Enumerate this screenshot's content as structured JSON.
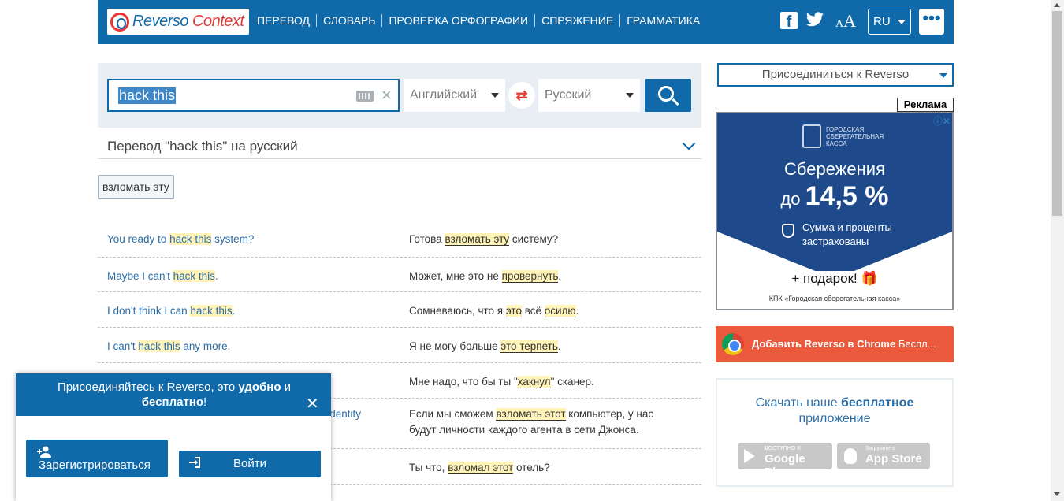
{
  "header": {
    "logo_reverso": "Reverso",
    "logo_context": "Context",
    "nav": [
      "ПЕРЕВОД",
      "СЛОВАРЬ",
      "ПРОВЕРКА ОРФОГРАФИИ",
      "СПРЯЖЕНИЕ",
      "ГРАММАТИКА"
    ],
    "language": "RU",
    "more": "•••"
  },
  "search": {
    "query": "hack this",
    "source_lang": "Английский",
    "target_lang": "Русский"
  },
  "translation": {
    "title": "Перевод \"hack this\" на русский",
    "chips": [
      "взломать эту"
    ]
  },
  "examples": [
    {
      "src": [
        "You ready to ",
        "hack this",
        " system?"
      ],
      "tgt": [
        "Готова ",
        "взломать эту",
        " систему?"
      ]
    },
    {
      "src": [
        "Maybe I can't ",
        "hack this",
        "."
      ],
      "tgt": [
        "Может, мне это не ",
        "провернуть",
        "."
      ]
    },
    {
      "src": [
        "I don't think I can ",
        "hack this",
        "."
      ],
      "tgt": [
        "Сомневаюсь, что я ",
        "это",
        " всё ",
        "осилю",
        "."
      ]
    },
    {
      "src": [
        "I can't ",
        "hack this",
        " any more."
      ],
      "tgt": [
        "Я не могу больше ",
        "это терпеть",
        "."
      ]
    },
    {
      "src": [
        "",
        "",
        ""
      ],
      "tgt": [
        "Мне надо, что бы ты \"",
        "хакнул",
        "\" сканер."
      ]
    },
    {
      "src": [
        "",
        "",
        "e identity"
      ],
      "tgt": [
        "Если мы сможем ",
        "взломать этот",
        " компьютер, у нас будут личности каждого агента в сети Джонса."
      ]
    },
    {
      "src": [
        "",
        "",
        ""
      ],
      "tgt": [
        "Ты что, ",
        "взломал этот",
        " отель?"
      ]
    }
  ],
  "sidebar": {
    "join": "Присоединиться к Reverso",
    "ad_label": "Реклама",
    "ad": {
      "bank_name": "ГОРОДСКАЯ СБЕРЕГАТЕЛЬНАЯ КАССА",
      "headline": "Сбережения",
      "rate_prefix": "до",
      "rate": "14,5 %",
      "note": "Сумма и проценты застрахованы",
      "gift": "+ подарок!",
      "footer": "КПК «Городская сберегательная касса»"
    },
    "chrome_bold": "Добавить Reverso в Chrome",
    "chrome_rest": " Беспл...",
    "app_title_1": "Скачать наше ",
    "app_title_bold": "бесплатное",
    "app_title_2": "приложение",
    "google_small": "ДОСТУПНО В",
    "google_big": "Google Play",
    "apple_small": "Загрузите в",
    "apple_big": "App Store"
  },
  "popup": {
    "msg_1": "Присоединяйтесь к Reverso, это ",
    "msg_bold_1": "удобно",
    "msg_2": " и ",
    "msg_bold_2": "бесплатно",
    "msg_3": "!",
    "register": "Зарегистрироваться",
    "login": "Войти"
  },
  "colors": {
    "brand_blue": "#106aaa",
    "highlight": "#fff3b8",
    "chrome_bar": "#eb5a3c"
  }
}
